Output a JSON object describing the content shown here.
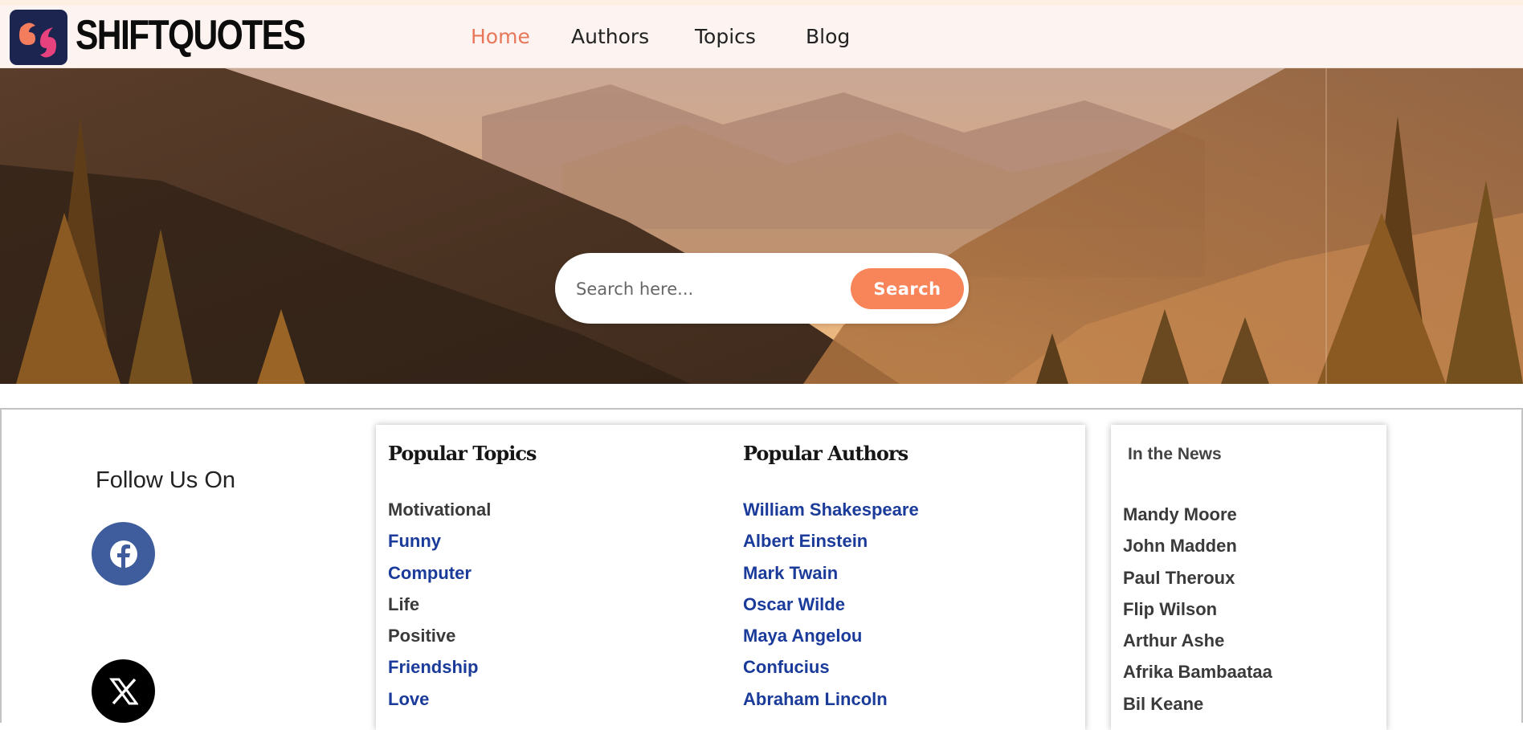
{
  "brand": {
    "name": "SHIFTQUOTES",
    "logo_icon": "quote-marks-logo-icon",
    "colors": {
      "logo_bg": "#1c2450",
      "accent": "#f8845a",
      "nav_active": "#e8775a"
    }
  },
  "nav": {
    "items": [
      {
        "label": "Home",
        "active": true
      },
      {
        "label": "Authors",
        "active": false
      },
      {
        "label": "Topics",
        "active": false
      },
      {
        "label": "Blog",
        "active": false
      }
    ]
  },
  "search": {
    "placeholder": "Search here...",
    "value": "",
    "button_label": "Search"
  },
  "follow": {
    "title": "Follow Us On",
    "networks": [
      {
        "icon": "facebook-icon",
        "color": "#3f5d9c"
      },
      {
        "icon": "x-twitter-icon",
        "color": "#000000"
      }
    ]
  },
  "popular_topics": {
    "title": "Popular Topics",
    "items": [
      {
        "label": "Motivational",
        "style": "gray"
      },
      {
        "label": "Funny",
        "style": "blue"
      },
      {
        "label": "Computer",
        "style": "blue"
      },
      {
        "label": "Life",
        "style": "gray"
      },
      {
        "label": "Positive",
        "style": "gray"
      },
      {
        "label": "Friendship",
        "style": "blue"
      },
      {
        "label": "Love",
        "style": "blue"
      }
    ]
  },
  "popular_authors": {
    "title": "Popular Authors",
    "items": [
      {
        "label": "William Shakespeare"
      },
      {
        "label": "Albert Einstein"
      },
      {
        "label": "Mark Twain"
      },
      {
        "label": "Oscar Wilde"
      },
      {
        "label": "Maya Angelou"
      },
      {
        "label": "Confucius"
      },
      {
        "label": "Abraham Lincoln"
      }
    ]
  },
  "news": {
    "title": "In the News",
    "items": [
      {
        "label": "Mandy Moore"
      },
      {
        "label": "John Madden"
      },
      {
        "label": "Paul Theroux"
      },
      {
        "label": "Flip Wilson"
      },
      {
        "label": "Arthur Ashe"
      },
      {
        "label": "Afrika Bambaataa"
      },
      {
        "label": "Bil Keane"
      }
    ]
  }
}
